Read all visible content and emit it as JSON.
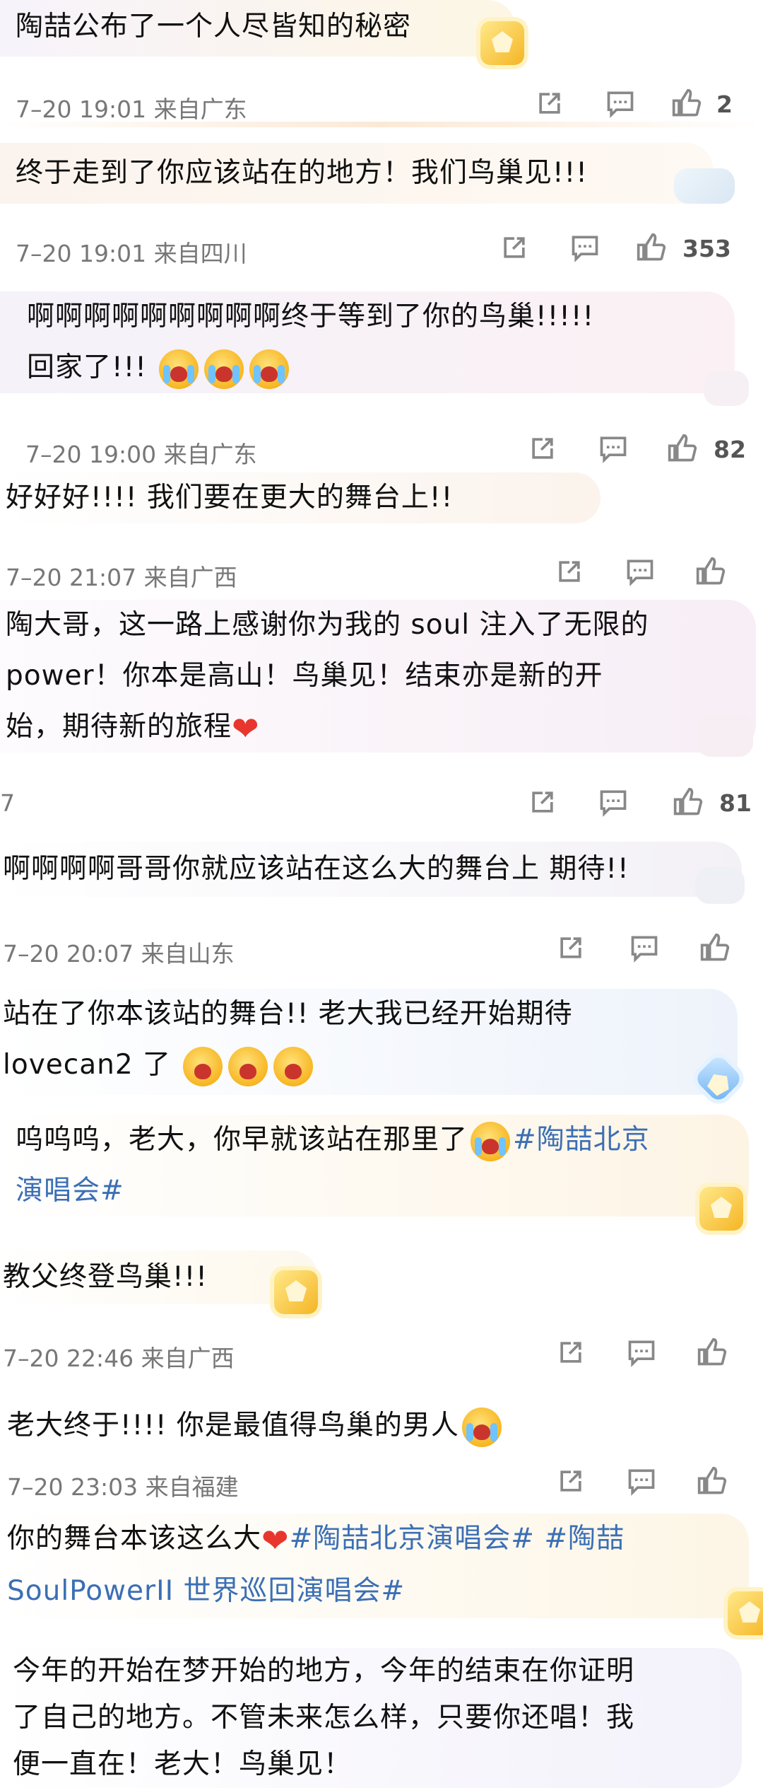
{
  "comments": [
    {
      "text": "陶喆公布了一个人尽皆知的秘密",
      "time": "7–20 19:01",
      "loc": "来自广东",
      "likes": "2"
    },
    {
      "text": "终于走到了你应该站在的地方！我们鸟巢见!!!",
      "time": "7–20 19:01",
      "loc": "来自四川",
      "likes": "353"
    },
    {
      "text1": "啊啊啊啊啊啊啊啊啊终于等到了你的鸟巢!!!!!",
      "text2": "回家了!!!",
      "time": "7–20 19:00",
      "loc": "来自广东",
      "likes": "82"
    },
    {
      "text": "好好好!!!! 我们要在更大的舞台上!!",
      "time": "7–20 21:07",
      "loc": "来自广西",
      "likes": ""
    },
    {
      "text1": "陶大哥，这一路上感谢你为我的 soul 注入了无限的",
      "text2": "power！你本是高山！鸟巢见！结束亦是新的开",
      "text3": "始，期待新的旅程",
      "time": "7",
      "loc": "",
      "likes": "81"
    },
    {
      "text": "啊啊啊啊哥哥你就应该站在这么大的舞台上 期待!!",
      "time": "7–20 20:07",
      "loc": "来自山东",
      "likes": ""
    },
    {
      "text1": "站在了你本该站的舞台!! 老大我已经开始期待",
      "text2": "lovecan2 了"
    },
    {
      "text1": "呜呜呜，老大，你早就该站在那里了",
      "tag1": "#陶喆北京",
      "tag2": "演唱会#"
    },
    {
      "text": "教父终登鸟巢!!!",
      "time": "7–20 22:46",
      "loc": "来自广西",
      "likes": ""
    },
    {
      "text": "老大终于!!!! 你是最值得鸟巢的男人",
      "time": "7–20 23:03",
      "loc": "来自福建",
      "likes": ""
    },
    {
      "text1": "你的舞台本该这么大",
      "tag1": "#陶喆北京演唱会# #陶喆",
      "tag2": "SoulPowerII 世界巡回演唱会#"
    },
    {
      "text1": "今年的开始在梦开始的地方，今年的结束在你证明",
      "text2": "了自己的地方。不管未来怎么样，只要你还唱！我",
      "text3": "便一直在！老大！鸟巢见！"
    }
  ],
  "icons": {
    "share": "share-icon",
    "comment": "comment-icon",
    "like": "thumbs-up-icon"
  },
  "colors": {
    "tag": "#3b6fb5",
    "meta": "#777777",
    "heart": "#e8362e"
  }
}
